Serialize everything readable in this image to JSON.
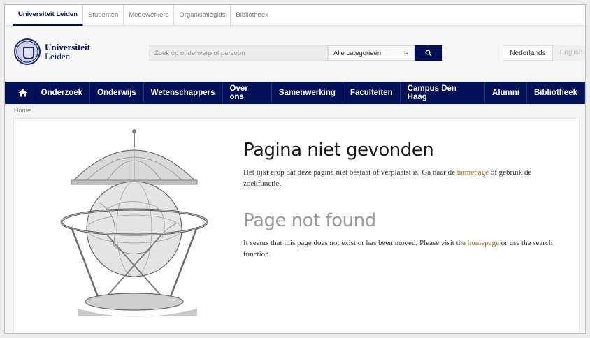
{
  "topbar": {
    "links": [
      {
        "label": "Universiteit Leiden",
        "active": true
      },
      {
        "label": "Studenten"
      },
      {
        "label": "Medewerkers"
      },
      {
        "label": "Organisatiegids"
      },
      {
        "label": "Bibliotheek"
      }
    ]
  },
  "header": {
    "logo_line1": "Universiteit",
    "logo_line2": "Leiden",
    "search_placeholder": "Zoek op onderwerp of persoon",
    "category_select": "Alle categorieën",
    "languages": {
      "nl": "Nederlands",
      "en": "English"
    }
  },
  "nav": {
    "items": [
      "Onderzoek",
      "Onderwijs",
      "Wetenschappers",
      "Over ons",
      "Samenwerking",
      "Faculteiten",
      "Campus Den Haag",
      "Alumni",
      "Bibliotheek"
    ]
  },
  "breadcrumb": "Home",
  "main": {
    "title_nl": "Pagina niet gevonden",
    "text_nl_1": "Het lijkt erop dat deze pagina niet bestaat of verplaatst is. Ga naar de ",
    "link_nl": "homepage",
    "text_nl_2": " of gebruik de zoekfunctie.",
    "title_en": "Page not found",
    "text_en_1": "It seems that this page does not exist or has been moved. Please visit the ",
    "link_en": "homepage",
    "text_en_2": " or use the search function."
  },
  "colors": {
    "brand": "#001158",
    "link": "#a86a1f"
  },
  "icons": {
    "home": "home-icon",
    "search": "search-icon",
    "chevron": "chevron-down-icon"
  }
}
